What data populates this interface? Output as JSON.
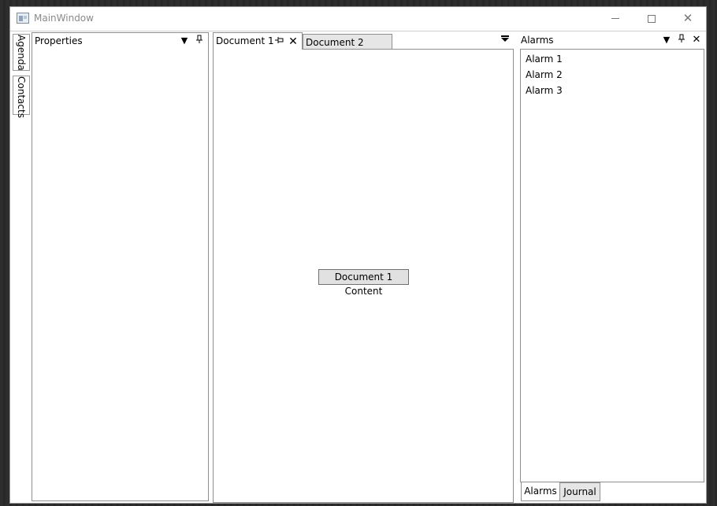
{
  "window": {
    "title": "MainWindow"
  },
  "side_tabs": [
    {
      "label": "Agenda"
    },
    {
      "label": "Contacts"
    }
  ],
  "properties_pane": {
    "title": "Properties"
  },
  "documents": {
    "tabs": [
      {
        "label": "Document 1",
        "active": true
      },
      {
        "label": "Document 2",
        "active": false
      }
    ],
    "content_label": "Document 1 Content"
  },
  "alarms_pane": {
    "title": "Alarms",
    "items": [
      "Alarm 1",
      "Alarm 2",
      "Alarm 3"
    ],
    "bottom_tabs": [
      {
        "label": "Alarms",
        "active": true
      },
      {
        "label": "Journal",
        "active": false
      }
    ]
  },
  "icons": {
    "dropdown": "chevron-down-icon",
    "pin": "pin-icon",
    "close": "close-icon",
    "document_menu": "document-list-icon"
  }
}
